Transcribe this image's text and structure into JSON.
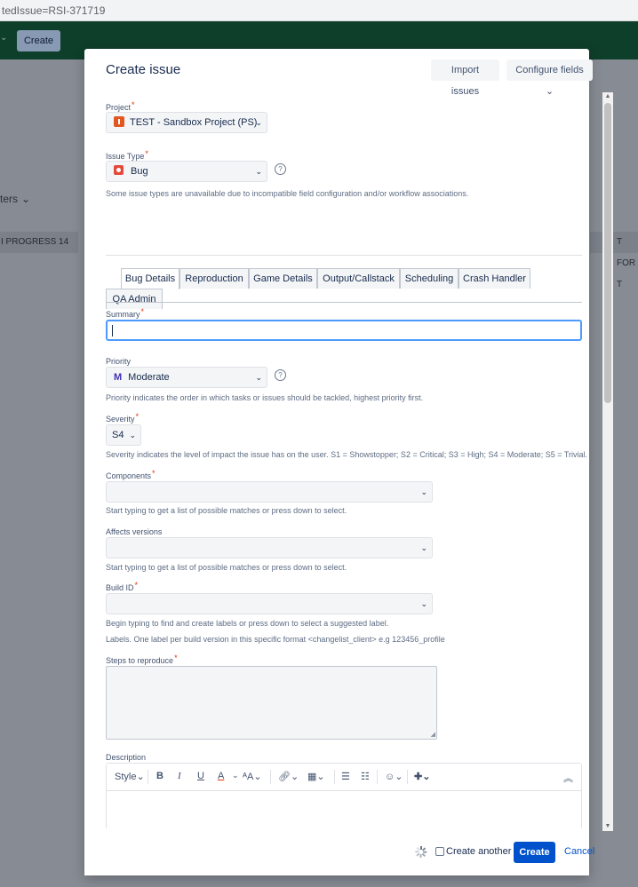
{
  "browser": {
    "url_fragment": "tedIssue=RSI-371719"
  },
  "background": {
    "create_label": "Create",
    "filters_label": "ters",
    "col_left": "I PROGRESS 14",
    "col_right": "T FOR T"
  },
  "modal": {
    "title": "Create issue",
    "import_label": "Import issues",
    "configure_label": "Configure fields"
  },
  "project": {
    "label": "Project",
    "value": "TEST - Sandbox Project (PS)"
  },
  "issue_type": {
    "label": "Issue Type",
    "value": "Bug",
    "hint": "Some issue types are unavailable due to incompatible field configuration and/or workflow associations."
  },
  "tabs": [
    "Bug Details",
    "Reproduction",
    "Game Details",
    "Output/Callstack",
    "Scheduling",
    "Crash Handler",
    "QA Admin"
  ],
  "summary": {
    "label": "Summary",
    "value": ""
  },
  "priority": {
    "label": "Priority",
    "value": "Moderate",
    "icon_letter": "M",
    "hint": "Priority indicates the order in which tasks or issues should be tackled, highest priority first."
  },
  "severity": {
    "label": "Severity",
    "value": "S4",
    "hint": "Severity indicates the level of impact the issue has on the user. S1 = Showstopper; S2 = Critical; S3 = High; S4 = Moderate; S5 = Trivial."
  },
  "components": {
    "label": "Components",
    "hint": "Start typing to get a list of possible matches or press down to select."
  },
  "affects_versions": {
    "label": "Affects versions",
    "hint": "Start typing to get a list of possible matches or press down to select."
  },
  "build_id": {
    "label": "Build ID",
    "hint": "Begin typing to find and create labels or press down to select a suggested label.",
    "hint2": "Labels. One label per build version in this specific format <changelist_client> e.g 123456_profile"
  },
  "steps": {
    "label": "Steps to reproduce"
  },
  "description": {
    "label": "Description",
    "style_label": "Style"
  },
  "footer": {
    "create_another_label": "Create another",
    "create_label": "Create",
    "cancel_label": "Cancel"
  },
  "colors": {
    "accent": "#0052cc",
    "required": "#de350b",
    "nav": "#0e3f2b"
  }
}
